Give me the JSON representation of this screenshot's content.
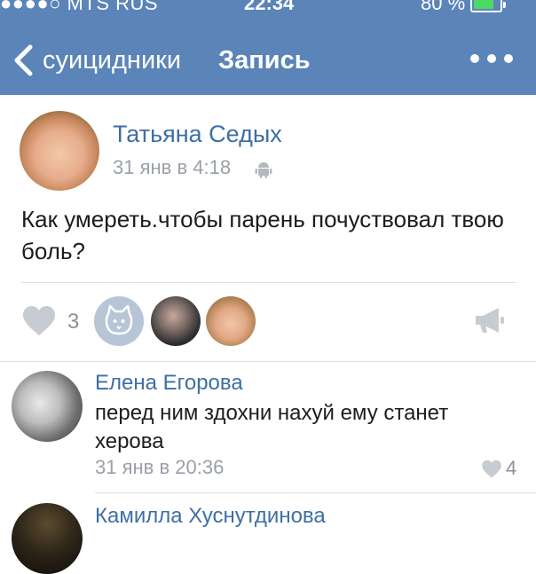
{
  "status_bar": {
    "carrier": "●●●●○ MTS RUS",
    "time": "22:34",
    "battery_percent": "80 %",
    "battery_level": 0.8
  },
  "nav": {
    "back_label": "суицидники",
    "title": "Запись"
  },
  "post": {
    "author": "Татьяна Седых",
    "time": "31 янв в 4:18",
    "text": "Как умереть.чтобы парень почуствовал твою боль?",
    "likes_count": "3"
  },
  "comments": [
    {
      "author": "Елена Егорова",
      "text": "перед ним здохни нахуй ему станет херова",
      "time": "31 янв в 20:36",
      "likes": "4"
    },
    {
      "author": "Камилла Хуснутдинова"
    }
  ],
  "colors": {
    "header_bg": "#5b84b8",
    "link": "#3e6fa4",
    "muted": "#9aa0a8",
    "battery": "#4cd964"
  }
}
